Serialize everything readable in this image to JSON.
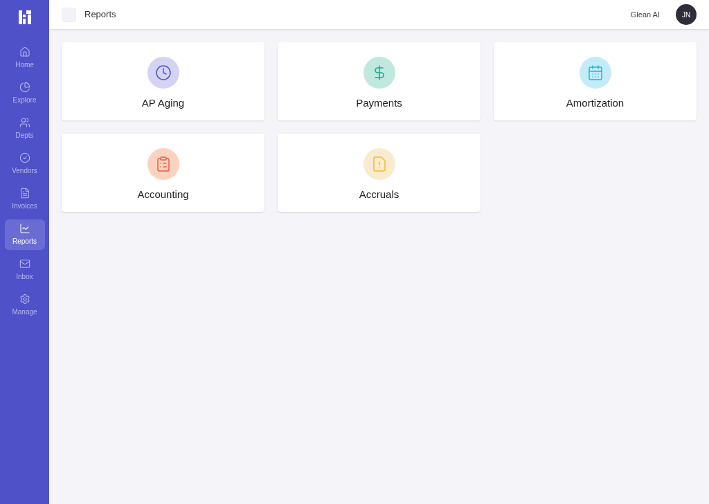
{
  "sidebar": {
    "items": [
      {
        "kind": "home",
        "label": "Home",
        "selected": false
      },
      {
        "kind": "explore",
        "label": "Explore",
        "selected": false
      },
      {
        "kind": "depts",
        "label": "Depts",
        "selected": false
      },
      {
        "kind": "vendors",
        "label": "Vendors",
        "selected": false
      },
      {
        "kind": "invoices",
        "label": "Invoices",
        "selected": false
      },
      {
        "kind": "reports",
        "label": "Reports",
        "selected": true
      },
      {
        "kind": "inbox",
        "label": "Inbox",
        "selected": false
      },
      {
        "kind": "manage",
        "label": "Manage",
        "selected": false
      }
    ]
  },
  "header": {
    "title": "Reports",
    "link": "Glean AI",
    "avatar": "JN"
  },
  "reports": [
    {
      "kind": "aging",
      "label": "AP Aging"
    },
    {
      "kind": "payments",
      "label": "Payments"
    },
    {
      "kind": "amortization",
      "label": "Amortization"
    },
    {
      "kind": "accounting",
      "label": "Accounting"
    },
    {
      "kind": "accruals",
      "label": "Accruals"
    }
  ]
}
